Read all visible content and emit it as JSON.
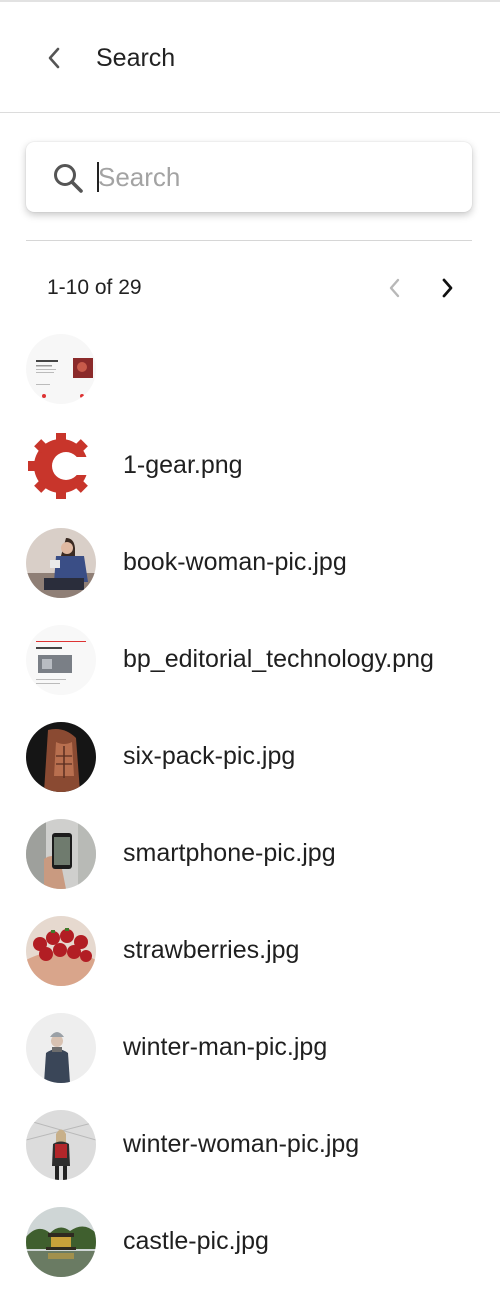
{
  "header": {
    "title": "Search",
    "back_icon": "chevron-left-icon"
  },
  "search": {
    "placeholder": "Search",
    "value": "",
    "icon": "search-icon"
  },
  "pagination": {
    "range_text": "1-10 of 29",
    "prev_icon": "chevron-left-icon",
    "next_icon": "chevron-right-icon"
  },
  "results": [
    {
      "name": "",
      "thumb": "editorial-page"
    },
    {
      "name": "1-gear.png",
      "thumb": "gear-logo"
    },
    {
      "name": "book-woman-pic.jpg",
      "thumb": "woman-reading-photo"
    },
    {
      "name": "bp_editorial_technology.png",
      "thumb": "editorial-technology-page"
    },
    {
      "name": "six-pack-pic.jpg",
      "thumb": "fitness-photo"
    },
    {
      "name": "smartphone-pic.jpg",
      "thumb": "smartphone-photo"
    },
    {
      "name": "strawberries.jpg",
      "thumb": "strawberries-photo"
    },
    {
      "name": "winter-man-pic.jpg",
      "thumb": "winter-man-photo"
    },
    {
      "name": "winter-woman-pic.jpg",
      "thumb": "winter-woman-photo"
    },
    {
      "name": "castle-pic.jpg",
      "thumb": "castle-photo"
    }
  ],
  "colors": {
    "gear_red": "#c8352b",
    "text": "#1f1f1f",
    "muted": "#a3a3a3",
    "divider": "#d6d6d6"
  }
}
